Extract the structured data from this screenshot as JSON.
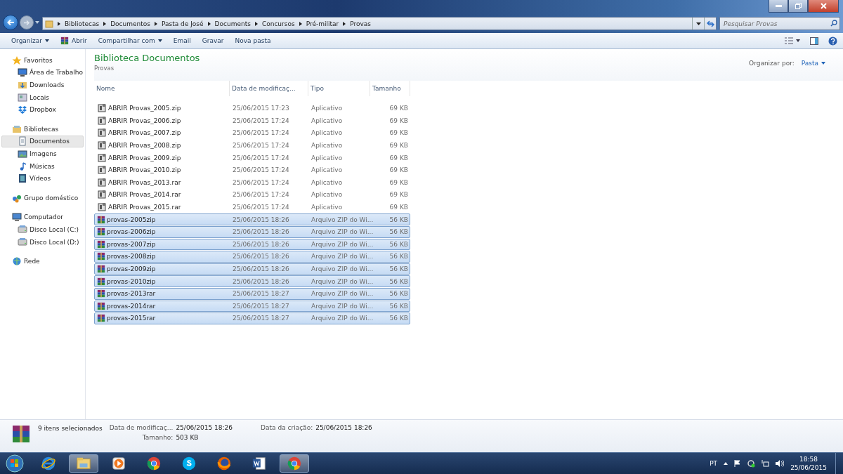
{
  "address": {
    "breadcrumbs": [
      "Bibliotecas",
      "Documentos",
      "Pasta de José",
      "Documents",
      "Concursos",
      "Pré-militar",
      "Provas"
    ],
    "search_placeholder": "Pesquisar Provas"
  },
  "toolbar": [
    {
      "label": "Organizar",
      "dropdown": true,
      "icon": false
    },
    {
      "label": "Abrir",
      "dropdown": false,
      "icon": true
    },
    {
      "label": "Compartilhar com",
      "dropdown": true,
      "icon": false
    },
    {
      "label": "Email",
      "dropdown": false,
      "icon": false
    },
    {
      "label": "Gravar",
      "dropdown": false,
      "icon": false
    },
    {
      "label": "Nova pasta",
      "dropdown": false,
      "icon": false
    }
  ],
  "sidebar": [
    {
      "label": "Favoritos",
      "kind": "star",
      "items": [
        {
          "label": "Área de Trabalho",
          "kind": "desktop",
          "selected": false
        },
        {
          "label": "Downloads",
          "kind": "download",
          "selected": false
        },
        {
          "label": "Locais",
          "kind": "places",
          "selected": false
        },
        {
          "label": "Dropbox",
          "kind": "dropbox",
          "selected": false
        }
      ]
    },
    {
      "label": "Bibliotecas",
      "kind": "library",
      "items": [
        {
          "label": "Documentos",
          "kind": "document",
          "selected": true
        },
        {
          "label": "Imagens",
          "kind": "image",
          "selected": false
        },
        {
          "label": "Músicas",
          "kind": "music",
          "selected": false
        },
        {
          "label": "Vídeos",
          "kind": "video",
          "selected": false
        }
      ]
    },
    {
      "label": "Grupo doméstico",
      "kind": "homegroup"
    },
    {
      "label": "Computador",
      "kind": "computer",
      "items": [
        {
          "label": "Disco Local (C:)",
          "kind": "drive",
          "selected": false
        },
        {
          "label": "Disco Local (D:)",
          "kind": "drive",
          "selected": false
        }
      ]
    },
    {
      "label": "Rede",
      "kind": "network"
    }
  ],
  "library": {
    "title": "Biblioteca Documentos",
    "subtitle": "Provas",
    "arrange_label": "Organizar por:",
    "arrange_value": "Pasta"
  },
  "table": {
    "columns": [
      "Nome",
      "Data de modificaç...",
      "Tipo",
      "Tamanho"
    ],
    "rows": [
      {
        "name": "ABRIR Provas_2005.zip",
        "date": "25/06/2015 17:23",
        "type": "Aplicativo",
        "size": "69 KB",
        "kind": "app",
        "selected": false
      },
      {
        "name": "ABRIR Provas_2006.zip",
        "date": "25/06/2015 17:24",
        "type": "Aplicativo",
        "size": "69 KB",
        "kind": "app",
        "selected": false
      },
      {
        "name": "ABRIR Provas_2007.zip",
        "date": "25/06/2015 17:24",
        "type": "Aplicativo",
        "size": "69 KB",
        "kind": "app",
        "selected": false
      },
      {
        "name": "ABRIR Provas_2008.zip",
        "date": "25/06/2015 17:24",
        "type": "Aplicativo",
        "size": "69 KB",
        "kind": "app",
        "selected": false
      },
      {
        "name": "ABRIR Provas_2009.zip",
        "date": "25/06/2015 17:24",
        "type": "Aplicativo",
        "size": "69 KB",
        "kind": "app",
        "selected": false
      },
      {
        "name": "ABRIR Provas_2010.zip",
        "date": "25/06/2015 17:24",
        "type": "Aplicativo",
        "size": "69 KB",
        "kind": "app",
        "selected": false
      },
      {
        "name": "ABRIR Provas_2013.rar",
        "date": "25/06/2015 17:24",
        "type": "Aplicativo",
        "size": "69 KB",
        "kind": "app",
        "selected": false
      },
      {
        "name": "ABRIR Provas_2014.rar",
        "date": "25/06/2015 17:24",
        "type": "Aplicativo",
        "size": "69 KB",
        "kind": "app",
        "selected": false
      },
      {
        "name": "ABRIR Provas_2015.rar",
        "date": "25/06/2015 17:24",
        "type": "Aplicativo",
        "size": "69 KB",
        "kind": "app",
        "selected": false
      },
      {
        "name": "provas-2005zip",
        "date": "25/06/2015 18:26",
        "type": "Arquivo ZIP do Wi...",
        "size": "56 KB",
        "kind": "archive",
        "selected": true
      },
      {
        "name": "provas-2006zip",
        "date": "25/06/2015 18:26",
        "type": "Arquivo ZIP do Wi...",
        "size": "56 KB",
        "kind": "archive",
        "selected": true
      },
      {
        "name": "provas-2007zip",
        "date": "25/06/2015 18:26",
        "type": "Arquivo ZIP do Wi...",
        "size": "56 KB",
        "kind": "archive",
        "selected": true
      },
      {
        "name": "provas-2008zip",
        "date": "25/06/2015 18:26",
        "type": "Arquivo ZIP do Wi...",
        "size": "56 KB",
        "kind": "archive",
        "selected": true
      },
      {
        "name": "provas-2009zip",
        "date": "25/06/2015 18:26",
        "type": "Arquivo ZIP do Wi...",
        "size": "56 KB",
        "kind": "archive",
        "selected": true
      },
      {
        "name": "provas-2010zip",
        "date": "25/06/2015 18:26",
        "type": "Arquivo ZIP do Wi...",
        "size": "56 KB",
        "kind": "archive",
        "selected": true
      },
      {
        "name": "provas-2013rar",
        "date": "25/06/2015 18:27",
        "type": "Arquivo ZIP do Wi...",
        "size": "56 KB",
        "kind": "archive",
        "selected": true
      },
      {
        "name": "provas-2014rar",
        "date": "25/06/2015 18:27",
        "type": "Arquivo ZIP do Wi...",
        "size": "56 KB",
        "kind": "archive",
        "selected": true
      },
      {
        "name": "provas-2015rar",
        "date": "25/06/2015 18:27",
        "type": "Arquivo ZIP do Wi...",
        "size": "56 KB",
        "kind": "archive",
        "selected": true
      }
    ]
  },
  "details": {
    "count": "9 itens selecionados",
    "fields": [
      {
        "label": "Data de modificaç...",
        "value": "25/06/2015 18:26"
      },
      {
        "label": "Tamanho:",
        "value": "503 KB"
      },
      {
        "label": "Data da criação:",
        "value": "25/06/2015 18:26"
      }
    ]
  },
  "taskbar": {
    "apps": [
      {
        "kind": "ie",
        "selected": false
      },
      {
        "kind": "explorer",
        "selected": true
      },
      {
        "kind": "media",
        "selected": false
      },
      {
        "kind": "chrome",
        "selected": false
      },
      {
        "kind": "skype",
        "selected": false
      },
      {
        "kind": "firefox",
        "selected": false
      },
      {
        "kind": "word",
        "selected": false
      },
      {
        "kind": "chrome",
        "selected": true
      }
    ],
    "language": "PT",
    "time": "18:58",
    "date": "25/06/2015"
  }
}
